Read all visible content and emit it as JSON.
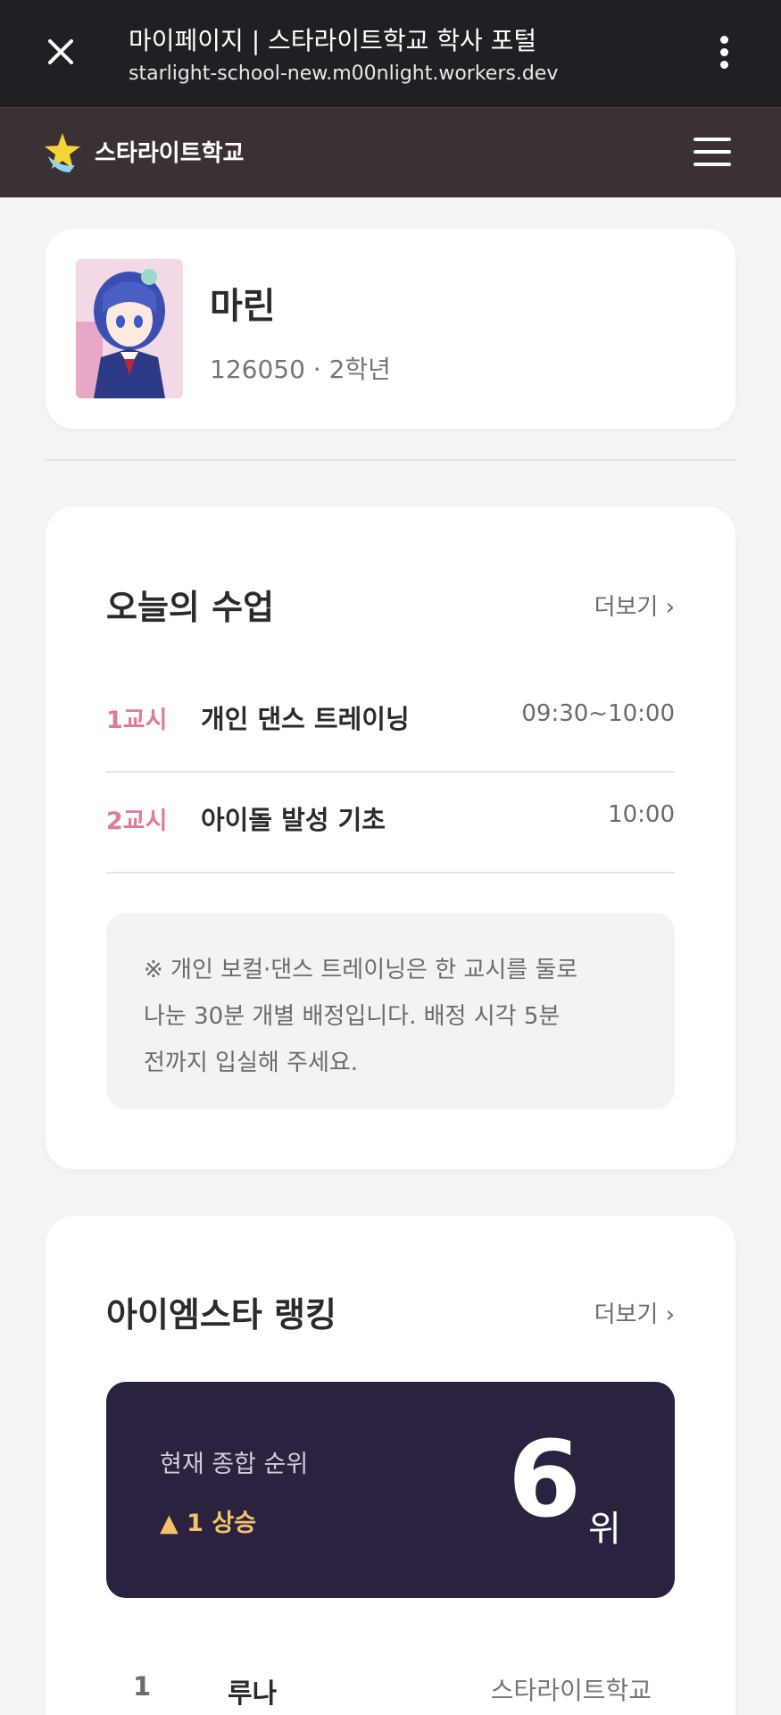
{
  "browser": {
    "title": "마이페이지 | 스타라이트학교 학사 포털",
    "url": "starlight-school-new.m00nlight.workers.dev",
    "close_icon": "close-icon",
    "menu_icon": "more-vert-icon"
  },
  "header": {
    "brand": "스타라이트학교",
    "logo_icon": "star-logo-icon",
    "menu_icon": "hamburger-menu-icon"
  },
  "profile": {
    "name": "마린",
    "meta": "126050 · 2학년"
  },
  "classes": {
    "title": "오늘의 수업",
    "more_label": "더보기 ›",
    "items": [
      {
        "period": "1교시",
        "name": "개인 댄스 트레이닝",
        "time": "09:30~10:00"
      },
      {
        "period": "2교시",
        "name": "아이돌 발성 기초",
        "time": "10:00"
      }
    ],
    "notice_lines": [
      "※ 개인 보컬·댄스 트레이닝은 한 교시를 둘로",
      "나눈 30분 개별 배정입니다. 배정 시각 5분",
      "전까지 입실해 주세요."
    ]
  },
  "ranking": {
    "title": "아이엠스타 랭킹",
    "more_label": "더보기 ›",
    "current_label": "현재 종합 순위",
    "change": "▲ 1 상승",
    "rank": "6",
    "rank_unit": "위",
    "list": [
      {
        "pos": "1",
        "name": "루나",
        "school": "스타라이트학교"
      }
    ]
  },
  "colors": {
    "accent_pink": "#e07a9c",
    "rank_box": "#2b2240",
    "rank_up": "#f2c36b",
    "header_bg": "#3b3034"
  }
}
